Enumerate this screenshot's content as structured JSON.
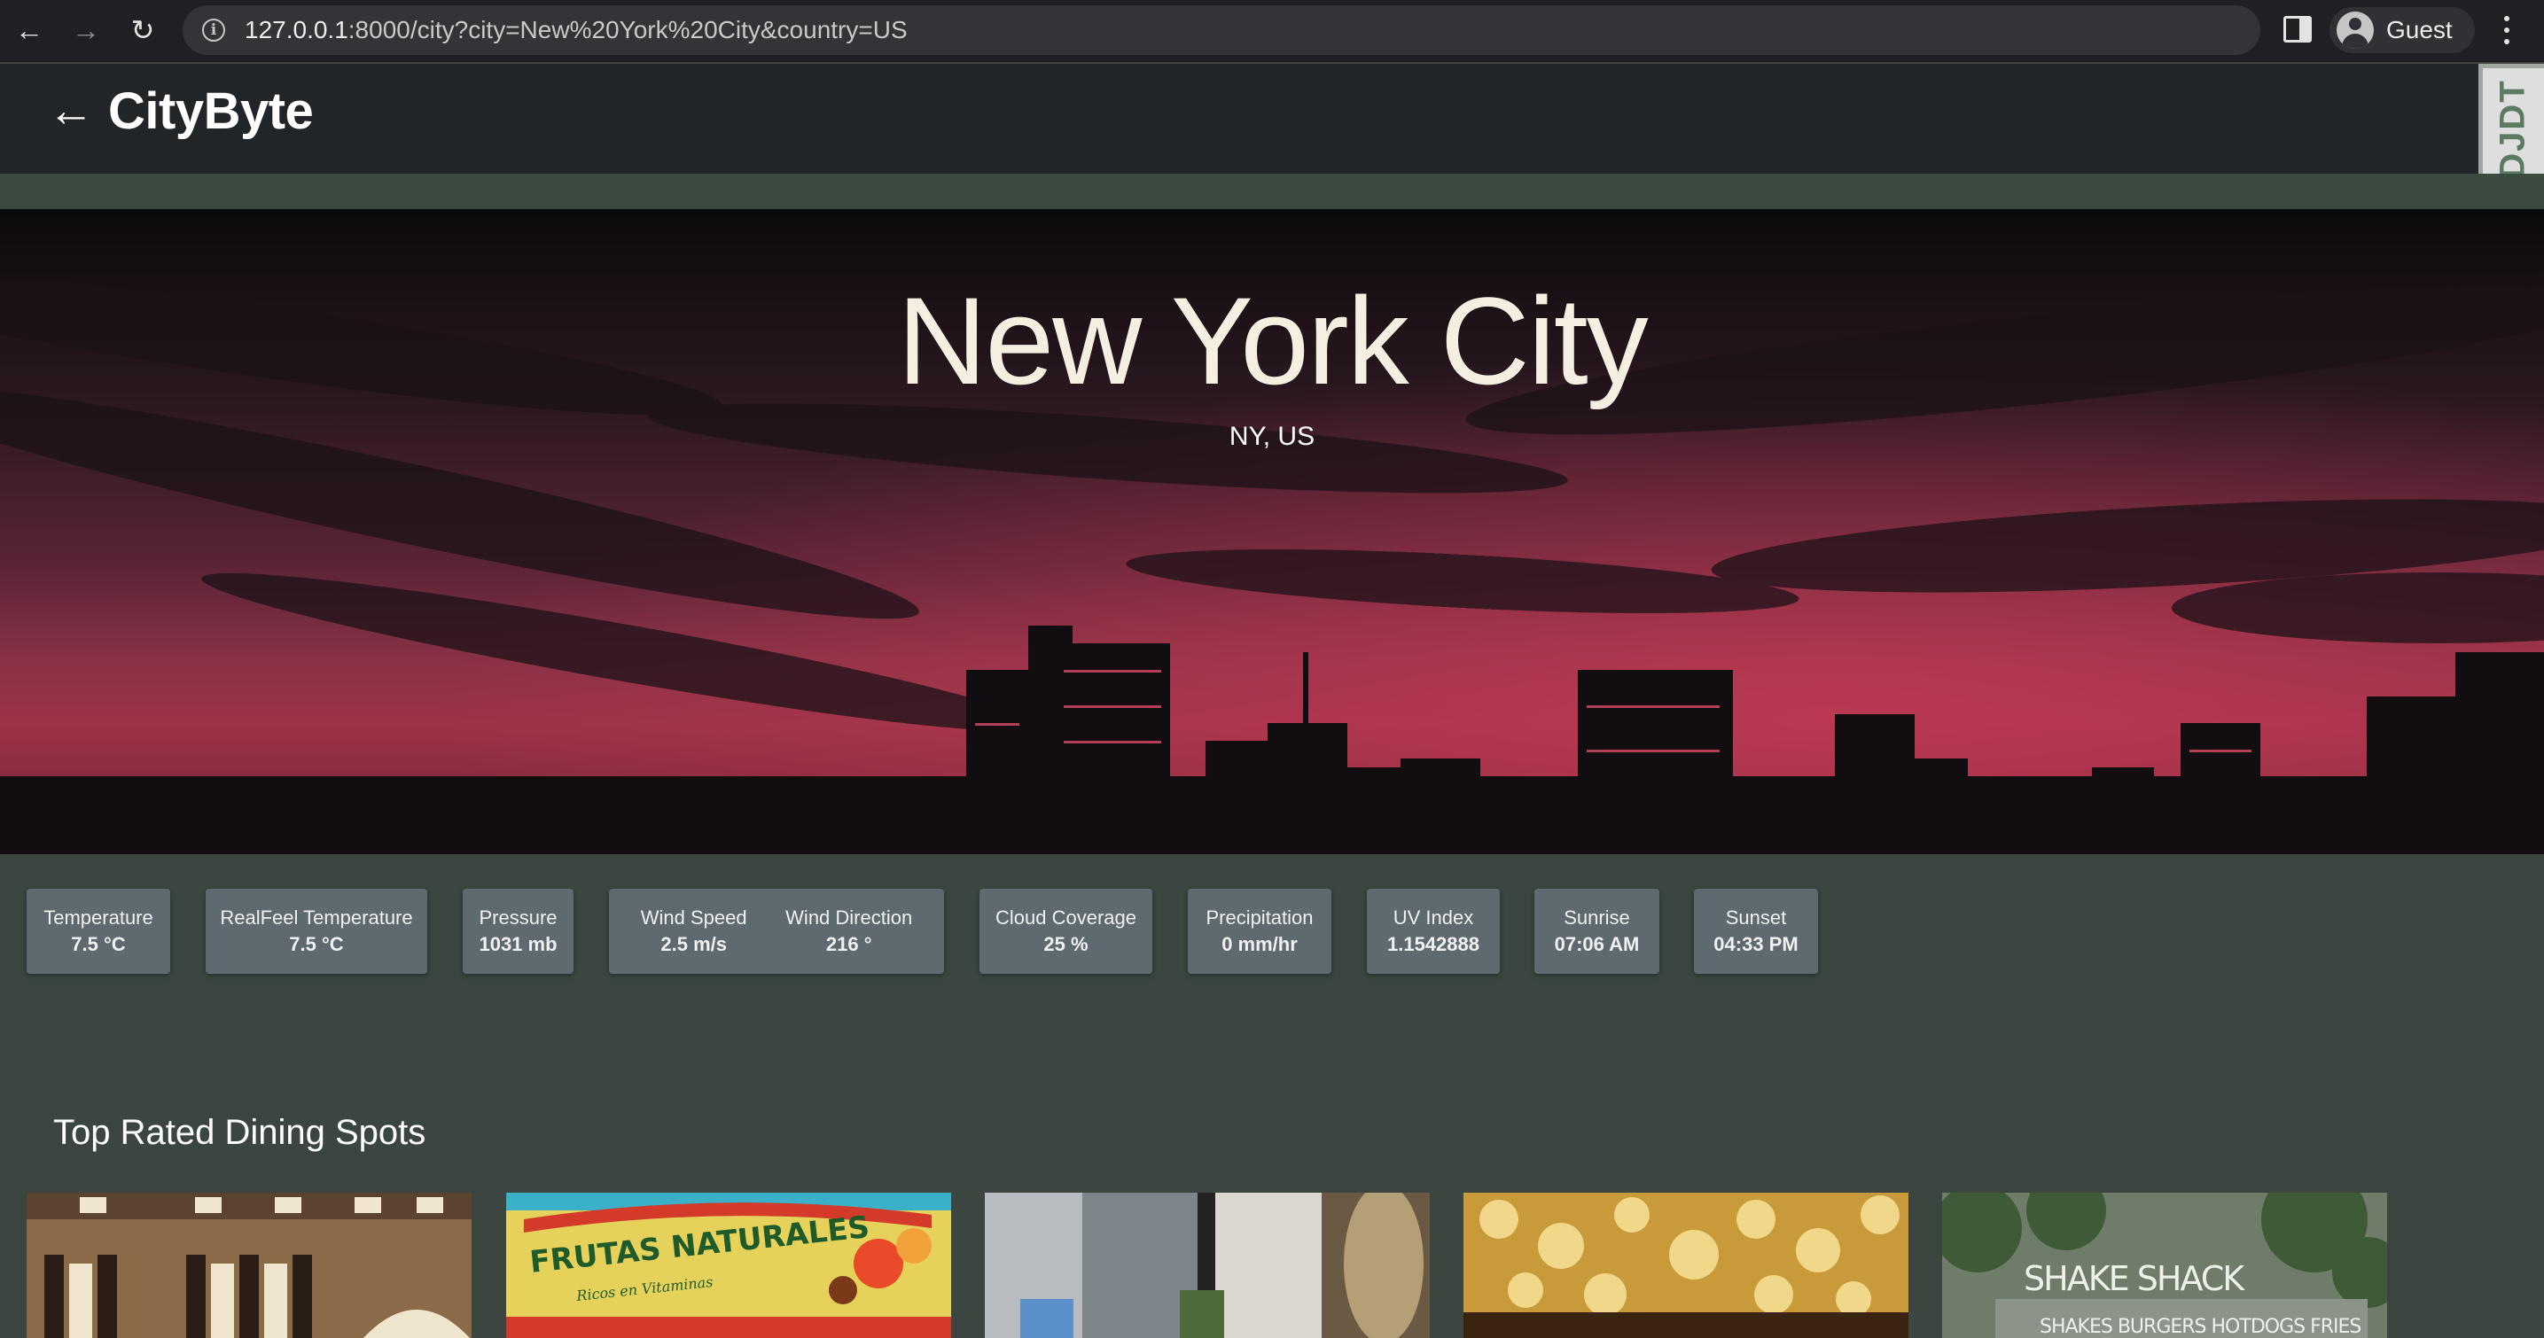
{
  "browser": {
    "url_host": "127.0.0.1",
    "url_rest": ":8000/city?city=New%20York%20City&country=US",
    "profile_name": "Guest",
    "icons": [
      "back-arrow-icon",
      "forward-arrow-icon",
      "reload-icon",
      "info-icon",
      "side-panel-icon",
      "profile-avatar-icon",
      "more-menu-icon"
    ]
  },
  "header": {
    "brand": "CityByte",
    "debug_toolbar_label": "DJDT"
  },
  "hero": {
    "city": "New York City",
    "region": "NY, US"
  },
  "metrics": [
    {
      "label": "Temperature",
      "value": "7.5 °C"
    },
    {
      "label": "RealFeel Temperature",
      "value": "7.5 °C"
    },
    {
      "label": "Pressure",
      "value": "1031 mb"
    },
    {
      "label": "Wind Speed",
      "value": "2.5 m/s"
    },
    {
      "label": "Wind Direction",
      "value": "216 °"
    },
    {
      "label": "Cloud Coverage",
      "value": "25 %"
    },
    {
      "label": "Precipitation",
      "value": "0 mm/hr"
    },
    {
      "label": "UV Index",
      "value": "1.1542888"
    },
    {
      "label": "Sunrise",
      "value": "07:06 AM"
    },
    {
      "label": "Sunset",
      "value": "04:33 PM"
    }
  ],
  "dining": {
    "title": "Top Rated Dining Spots",
    "photo_texts": [
      "FRUTAS NATURALES",
      "Ricos en Vitaminas",
      "SHAKE SHACK",
      "SHAKES BURGERS HOTDOGS FRIES"
    ]
  },
  "colors": {
    "page_bg": "#3a463f",
    "header_bg": "#212528",
    "card_bg": "#5e6a6f",
    "title_text": "#f5efe2"
  }
}
